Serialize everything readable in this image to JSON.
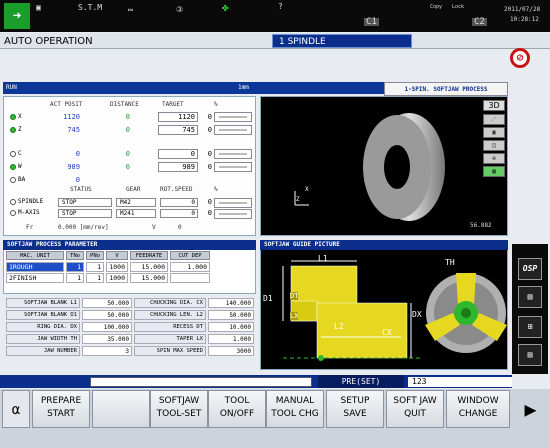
{
  "statusbar": {
    "stm_label": "S.T.M",
    "alarm_label": "?",
    "copy_label": "Copy",
    "lock_label": "Lock",
    "date": "2011/07/28",
    "time": "10:28:12",
    "c1": "C1",
    "c2": "C2"
  },
  "header": {
    "mode_title": "AUTO OPERATION",
    "spindle_label": "1 SPINDLE"
  },
  "run_bar": {
    "run_label": "RUN",
    "unit": "1mm",
    "tab_title": "1-SPIN. SOFTJAW PROCESS"
  },
  "position": {
    "headers": {
      "act_posit": "ACT POSIT",
      "distance": "DISTANCE",
      "target": "TARGET",
      "pct": "%"
    },
    "rows": [
      {
        "axis": "X",
        "act": "1120",
        "dist": "0",
        "target": "1120",
        "pct": "0"
      },
      {
        "axis": "Z",
        "act": "745",
        "dist": "0",
        "target": "745",
        "pct": "0"
      },
      {
        "axis": "C",
        "act": "0",
        "dist": "0",
        "target": "0",
        "pct": "0"
      },
      {
        "axis": "W",
        "act": "989",
        "dist": "0",
        "target": "989",
        "pct": "0"
      },
      {
        "axis": "BA",
        "act": "0",
        "dist": "",
        "target": "",
        "pct": ""
      }
    ]
  },
  "spindle_status": {
    "headers": {
      "status": "STATUS",
      "gear": "GEAR",
      "rot_speed": "ROT.SPEED",
      "pct": "%"
    },
    "rows": [
      {
        "name": "SPINDLE",
        "status": "STOP",
        "gear": "M42",
        "speed": "0",
        "pct": "0"
      },
      {
        "name": "M-AXIS",
        "status": "STOP",
        "gear": "M241",
        "speed": "0",
        "pct": "0"
      }
    ],
    "fr_label": "Fr",
    "fr_value": "0.000 [mm/rev]",
    "v_label": "V",
    "v_value": "0"
  },
  "view3d": {
    "label_3d": "3D",
    "axis_x": "X",
    "axis_z": "Z",
    "readout": "56.882"
  },
  "softjaw_process": {
    "title": "SOFTJAW PROCESS PARAMETER",
    "headers": [
      "MAC. UNIT",
      "TNo",
      "PNo",
      "V",
      "FEEDRATE",
      "CUT DEP"
    ],
    "rows": [
      {
        "unit": "1ROUGH",
        "tno": "1",
        "pno": "1",
        "v": "1000",
        "feed": "15.000",
        "cut": "1.000"
      },
      {
        "unit": "2FINISH",
        "tno": "1",
        "pno": "1",
        "v": "1000",
        "feed": "15.000",
        "cut": ""
      }
    ]
  },
  "blank_params": [
    {
      "label": "SOFTJAW BLANK L1",
      "value": "50.000",
      "label2": "CHUCKING DIA. CX",
      "value2": "140.000"
    },
    {
      "label": "SOFTJAW BLANK D1",
      "value": "50.000",
      "label2": "CHUCKING LEN. L2",
      "value2": "50.000"
    },
    {
      "label": "RING DIA. DX",
      "value": "100.000",
      "label2": "RECESS DT",
      "value2": "10.000"
    },
    {
      "label": "JAW WIDTH TH",
      "value": "35.000",
      "label2": "TAPER LX",
      "value2": "1.000"
    },
    {
      "label": "JAW NUMBER",
      "value": "3",
      "label2": "SPIN MAX SPEED",
      "value2": "3000"
    }
  ],
  "guide": {
    "title": "SOFTJAW GUIDE PICTURE",
    "labels": {
      "l1": "L1",
      "d1": "D1",
      "dt": "DT",
      "lx": "LX",
      "l2": "L2",
      "cx": "CX",
      "th": "TH",
      "dx": "DX"
    }
  },
  "input": {
    "preset_label": "PRE(SET)",
    "preset_value": "123"
  },
  "fkeys": [
    {
      "line1": "PREPARE",
      "line2": "START"
    },
    {
      "line1": "",
      "line2": ""
    },
    {
      "line1": "SOFTJAW",
      "line2": "TOOL-SET"
    },
    {
      "line1": "TOOL",
      "line2": "ON/OFF"
    },
    {
      "line1": "MANUAL",
      "line2": "TOOL CHG"
    },
    {
      "line1": "SETUP",
      "line2": "SAVE"
    },
    {
      "line1": "SOFT JAW",
      "line2": "QUIT"
    },
    {
      "line1": "WINDOW",
      "line2": "CHANGE"
    }
  ],
  "right_strip": {
    "osp_label": "OSP"
  },
  "colors": {
    "title_blue": "#0b2e8c",
    "value_blue": "#1f3cc0",
    "value_green": "#1f9a2f",
    "accent_yellow": "#e6d820",
    "accent_green": "#2eb82e"
  }
}
